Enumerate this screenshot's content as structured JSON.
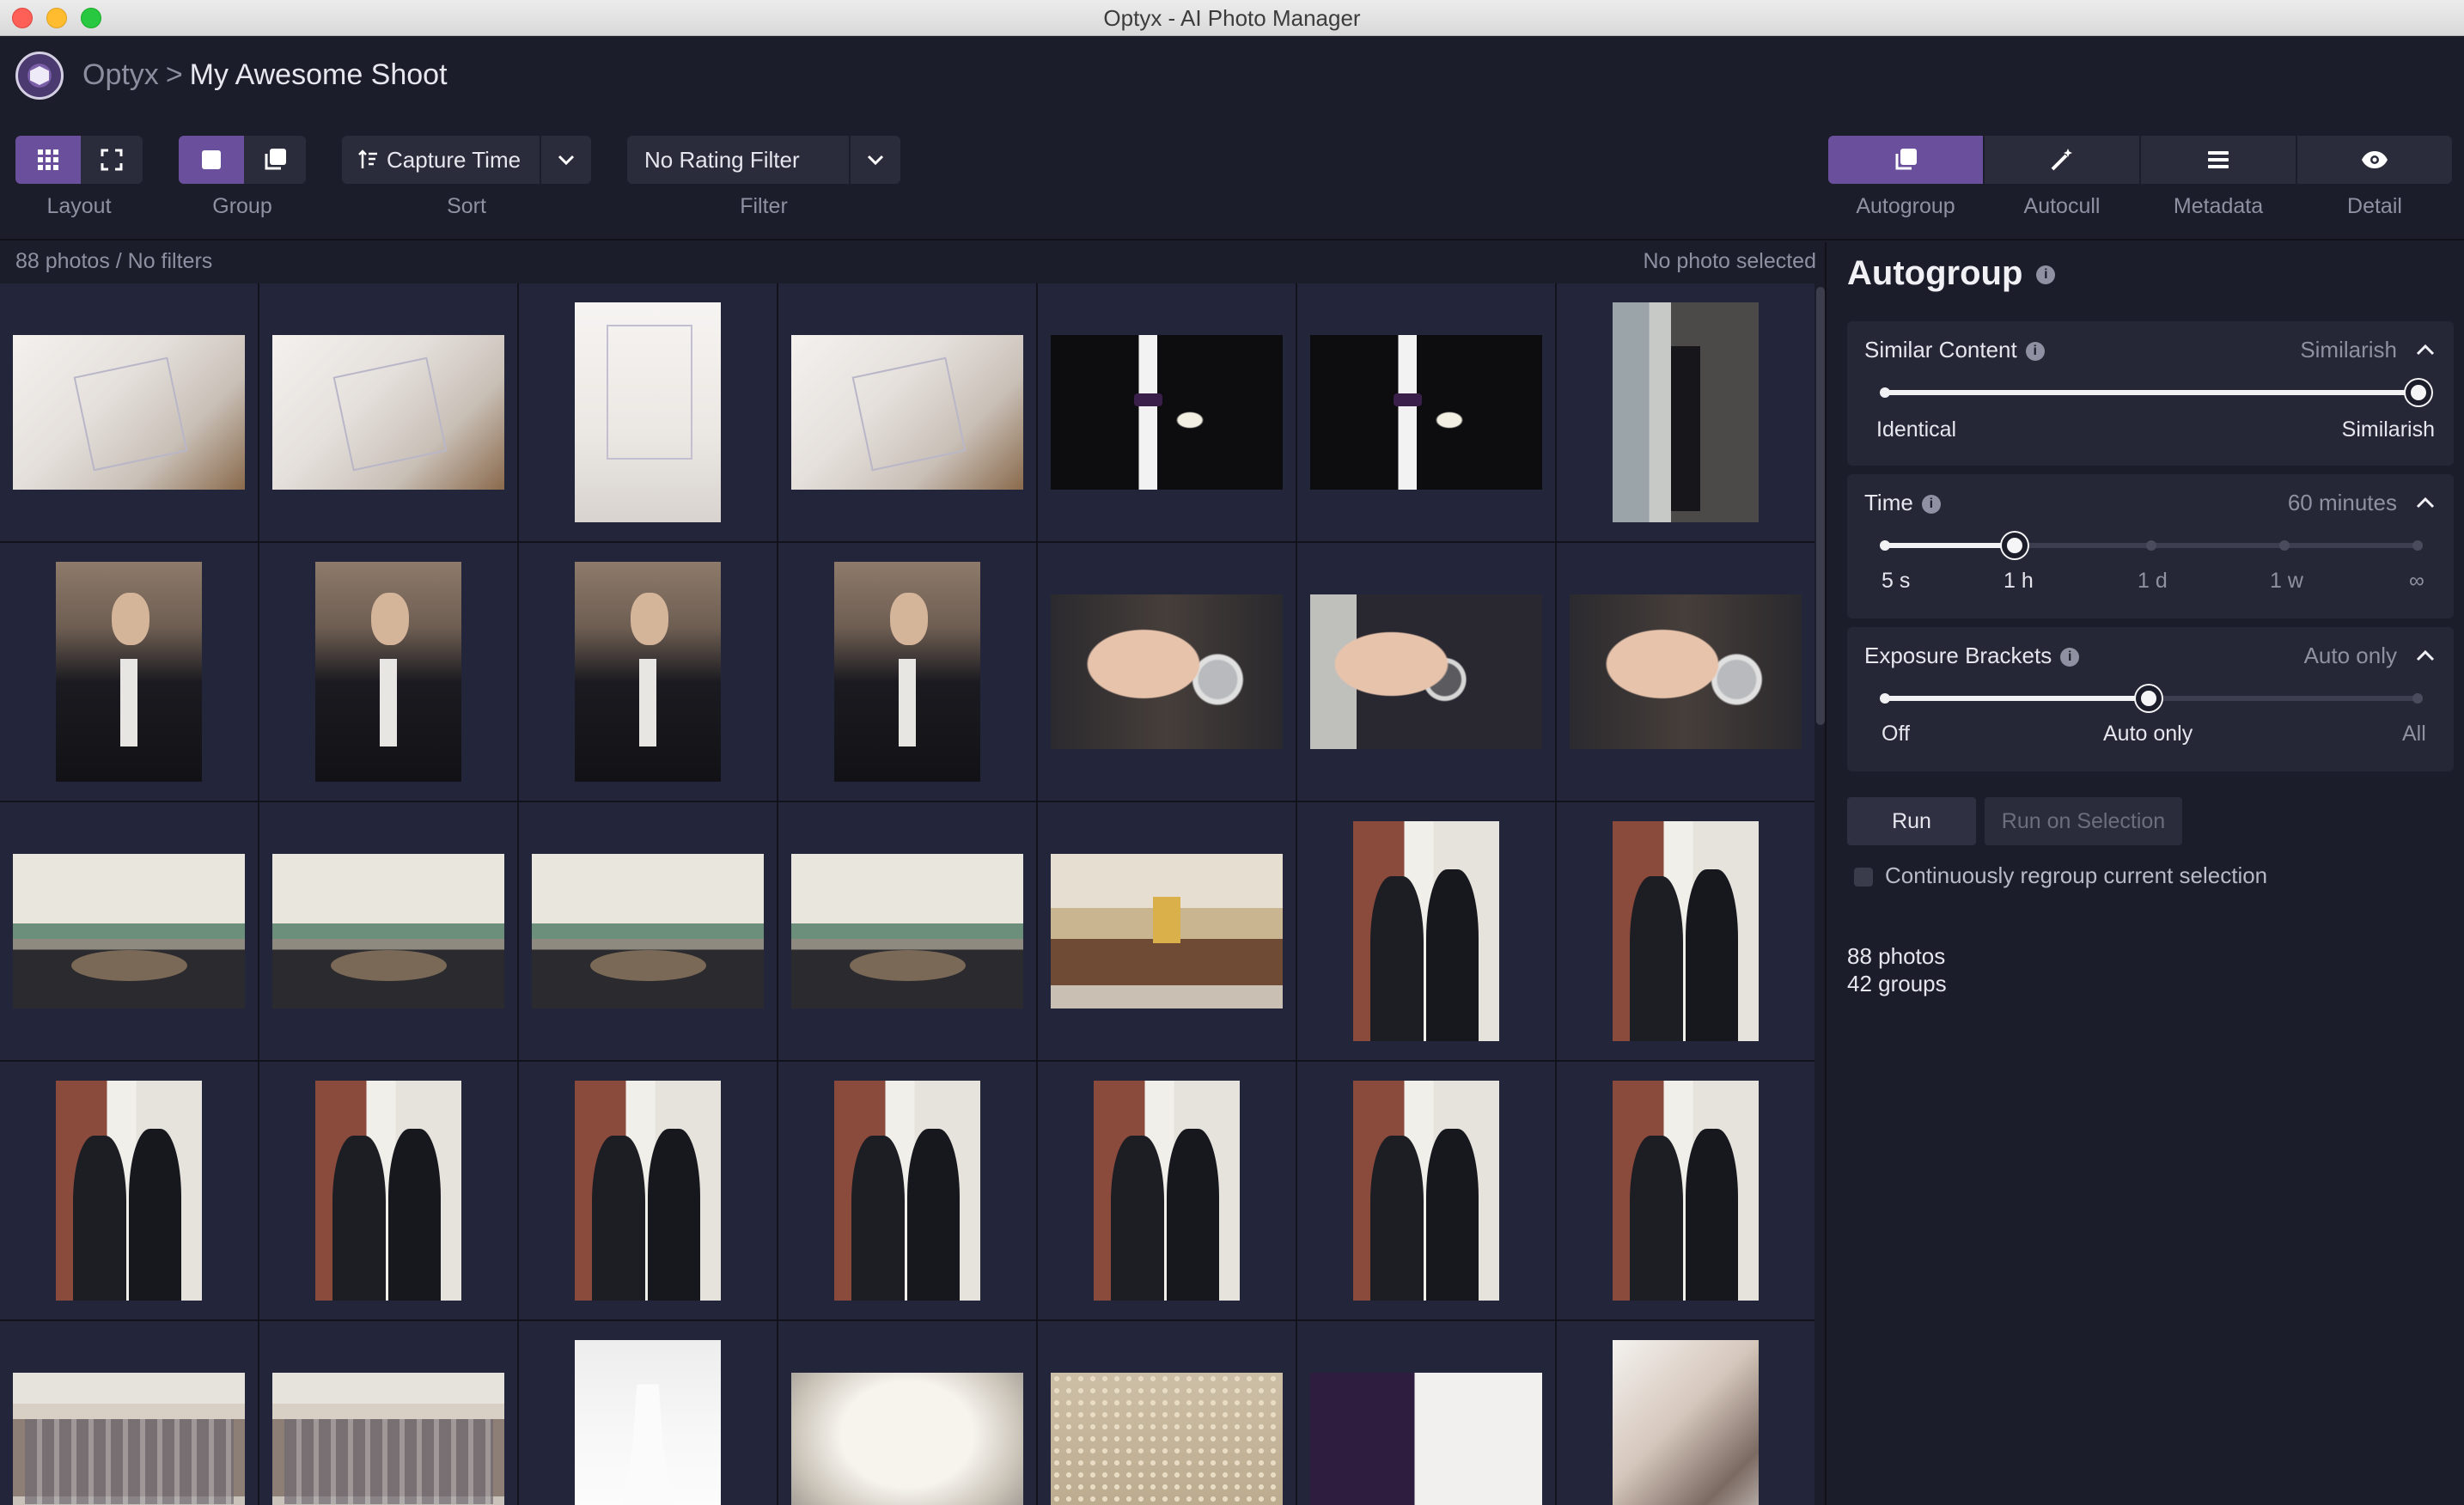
{
  "window": {
    "title": "Optyx - AI Photo Manager"
  },
  "breadcrumb": {
    "app": "Optyx",
    "separator": ">",
    "project": "My Awesome Shoot"
  },
  "toolbar": {
    "layout_label": "Layout",
    "group_label": "Group",
    "sort_label": "Sort",
    "sort_value": "Capture Time",
    "filter_label": "Filter",
    "filter_value": "No Rating Filter"
  },
  "panel_tabs": [
    {
      "label": "Autogroup",
      "icon": "autogroup-icon",
      "active": true
    },
    {
      "label": "Autocull",
      "icon": "magic-wand-icon",
      "active": false
    },
    {
      "label": "Metadata",
      "icon": "list-icon",
      "active": false
    },
    {
      "label": "Detail",
      "icon": "eye-icon",
      "active": false
    }
  ],
  "status": {
    "count": "88 photos / No filters",
    "selection": "No photo selected"
  },
  "grid": {
    "photos": [
      {
        "subject": "invitation cards",
        "orientation": "landscape"
      },
      {
        "subject": "invitation card close-up",
        "orientation": "landscape"
      },
      {
        "subject": "invitation card",
        "orientation": "portrait"
      },
      {
        "subject": "invitation cards in basket",
        "orientation": "landscape"
      },
      {
        "subject": "tuxedo boutonniere",
        "orientation": "landscape"
      },
      {
        "subject": "tuxedo boutonniere",
        "orientation": "landscape"
      },
      {
        "subject": "groom by window",
        "orientation": "portrait"
      },
      {
        "subject": "groom bow tie",
        "orientation": "portrait"
      },
      {
        "subject": "groom portrait",
        "orientation": "portrait"
      },
      {
        "subject": "groom portrait",
        "orientation": "portrait"
      },
      {
        "subject": "groom portrait",
        "orientation": "portrait"
      },
      {
        "subject": "groom watch",
        "orientation": "landscape"
      },
      {
        "subject": "groom watch",
        "orientation": "landscape"
      },
      {
        "subject": "groom watch",
        "orientation": "landscape"
      },
      {
        "subject": "groomsmen at table",
        "orientation": "landscape"
      },
      {
        "subject": "groomsmen at table",
        "orientation": "landscape"
      },
      {
        "subject": "groomsmen at table",
        "orientation": "landscape"
      },
      {
        "subject": "groomsmen at table",
        "orientation": "landscape"
      },
      {
        "subject": "chapel interior",
        "orientation": "landscape"
      },
      {
        "subject": "two men in suits",
        "orientation": "portrait"
      },
      {
        "subject": "two men in suits",
        "orientation": "portrait"
      },
      {
        "subject": "two men in suits",
        "orientation": "portrait"
      },
      {
        "subject": "two men in suits",
        "orientation": "portrait"
      },
      {
        "subject": "two men in suits",
        "orientation": "portrait"
      },
      {
        "subject": "two men in suits",
        "orientation": "portrait"
      },
      {
        "subject": "two men in suits",
        "orientation": "portrait"
      },
      {
        "subject": "two men in suits",
        "orientation": "portrait"
      },
      {
        "subject": "two men in suits",
        "orientation": "portrait"
      },
      {
        "subject": "bridesmaids in plaid",
        "orientation": "landscape"
      },
      {
        "subject": "bridesmaids in plaid",
        "orientation": "landscape"
      },
      {
        "subject": "wedding dress hanging",
        "orientation": "portrait"
      },
      {
        "subject": "wedding dress bodice",
        "orientation": "landscape"
      },
      {
        "subject": "wedding dress beads",
        "orientation": "landscape"
      },
      {
        "subject": "dresses on rack",
        "orientation": "landscape"
      },
      {
        "subject": "bride with veil",
        "orientation": "portrait"
      }
    ]
  },
  "autogroup": {
    "title": "Autogroup",
    "similar_content": {
      "title": "Similar Content",
      "value": "Similarish",
      "min_label": "Identical",
      "max_label": "Similarish",
      "level": 1.0
    },
    "time": {
      "title": "Time",
      "value": "60 minutes",
      "ticks": [
        "5 s",
        "1 h",
        "1 d",
        "1 w",
        "∞"
      ],
      "selected_index": 1
    },
    "exposure": {
      "title": "Exposure Brackets",
      "value": "Auto only",
      "ticks": [
        "Off",
        "Auto only",
        "All"
      ],
      "selected_index": 1
    },
    "run_label": "Run",
    "run_selection_label": "Run on Selection",
    "checkbox_label": "Continuously regroup current selection",
    "stats": {
      "photos": "88 photos",
      "groups": "42 groups"
    }
  },
  "colors": {
    "accent": "#6a4f9c",
    "background": "#1b1d2a",
    "panel_section": "#252736"
  }
}
